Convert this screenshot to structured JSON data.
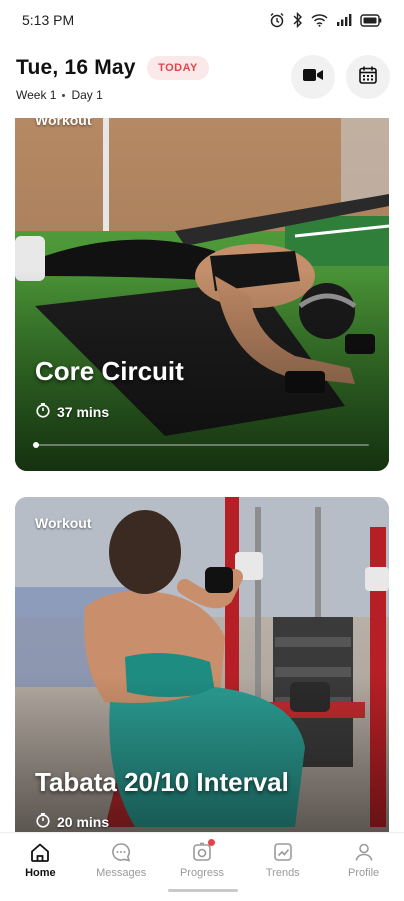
{
  "status_bar": {
    "time": "5:13 PM"
  },
  "header": {
    "date": "Tue, 16 May",
    "today_badge": "TODAY",
    "week": "Week 1",
    "day": "Day 1"
  },
  "workouts": [
    {
      "category": "Workout",
      "title": "Core Circuit",
      "duration": "37 mins",
      "progress": 0
    },
    {
      "category": "Workout",
      "title": "Tabata 20/10 Interval",
      "duration": "20 mins"
    }
  ],
  "nav": {
    "items": [
      {
        "label": "Home",
        "icon": "home-icon",
        "active": true
      },
      {
        "label": "Messages",
        "icon": "chat-icon"
      },
      {
        "label": "Progress",
        "icon": "progress-icon",
        "badge": true
      },
      {
        "label": "Trends",
        "icon": "trends-icon"
      },
      {
        "label": "Profile",
        "icon": "profile-icon"
      }
    ]
  },
  "colors": {
    "accent": "#e2444a",
    "badge_bg": "#fbe9ea"
  }
}
